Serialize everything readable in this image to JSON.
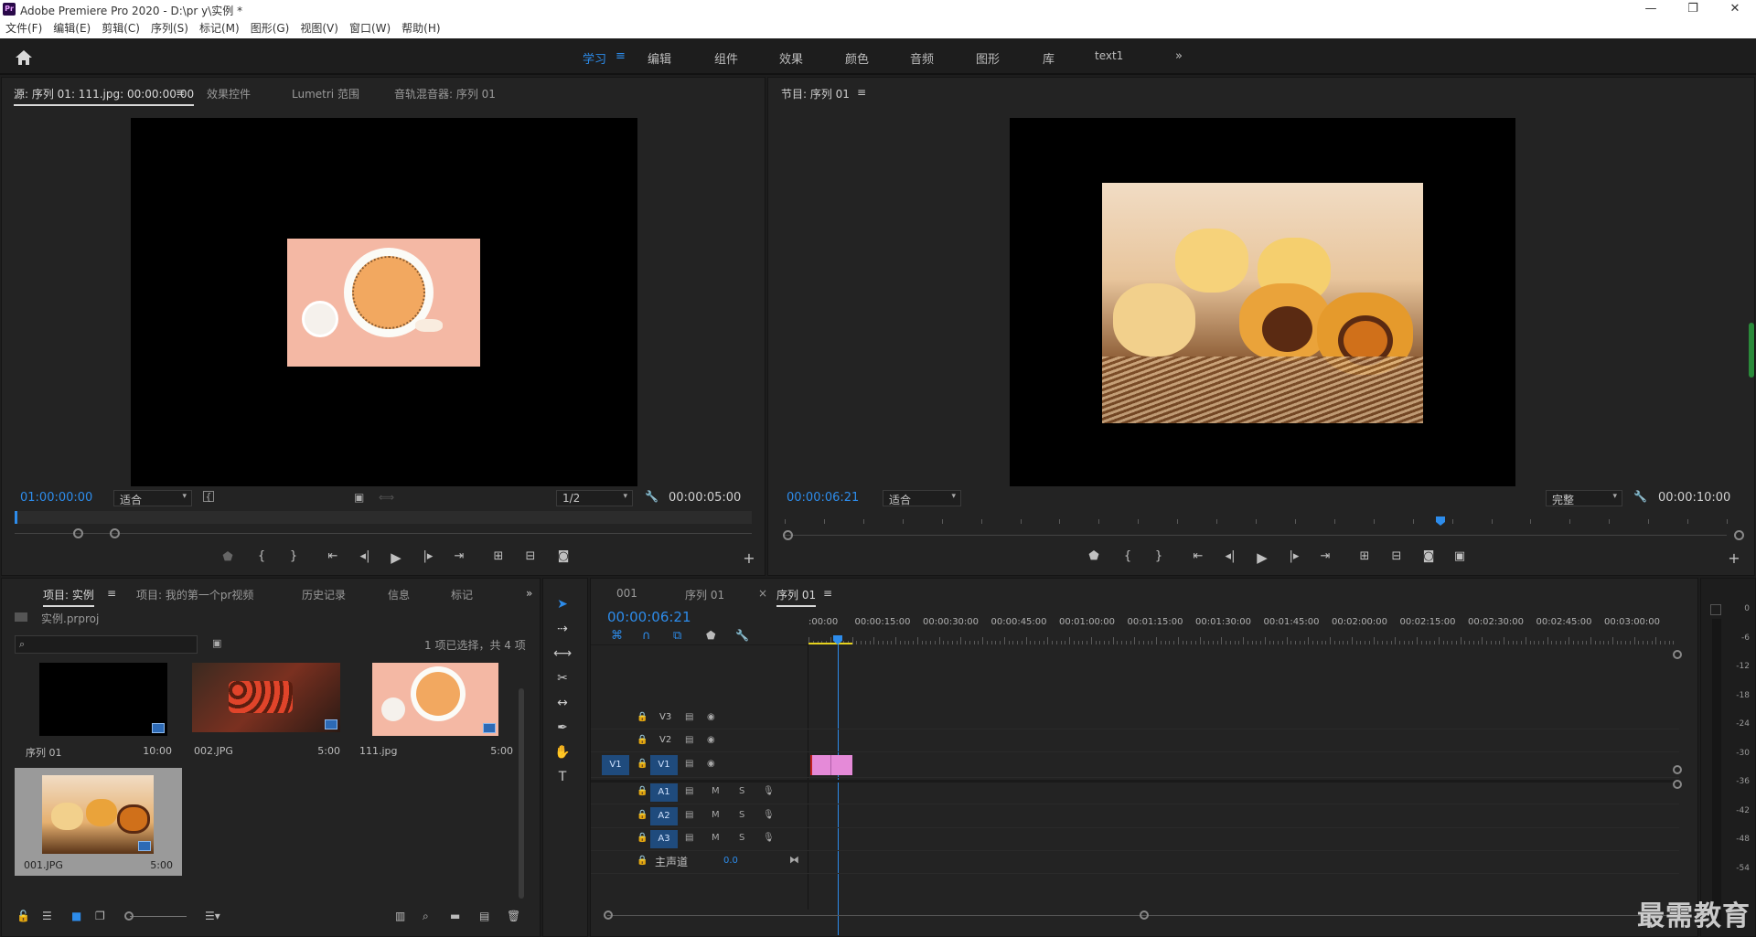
{
  "window": {
    "title": "Adobe Premiere Pro 2020 - D:\\pr y\\实例 *",
    "app_icon": "Pr",
    "controls": [
      "—",
      "❐",
      "✕"
    ]
  },
  "menu": [
    "文件(F)",
    "编辑(E)",
    "剪辑(C)",
    "序列(S)",
    "标记(M)",
    "图形(G)",
    "视图(V)",
    "窗口(W)",
    "帮助(H)"
  ],
  "workspaces": {
    "items": [
      "学习",
      "编辑",
      "组件",
      "效果",
      "颜色",
      "音频",
      "图形",
      "库",
      "text1"
    ],
    "active": "学习",
    "more": "»"
  },
  "source_panel": {
    "tabs": [
      "源: 序列 01: 111.jpg: 00:00:00:00",
      "效果控件",
      "Lumetri 范围",
      "音轨混音器: 序列 01"
    ],
    "timecode_left": "01:00:00:00",
    "zoom": "适合",
    "resolution": "1/2",
    "timecode_right": "00:00:05:00"
  },
  "program_panel": {
    "tab": "节目: 序列 01",
    "timecode_left": "00:00:06:21",
    "zoom": "适合",
    "quality": "完整",
    "timecode_right": "00:00:10:00"
  },
  "project_panel": {
    "tabs": [
      "项目: 实例",
      "项目: 我的第一个pr视频",
      "历史记录",
      "信息",
      "标记"
    ],
    "file": "实例.prproj",
    "selection": "1 项已选择，共 4 项",
    "items": [
      {
        "name": "序列 01",
        "duration": "10:00"
      },
      {
        "name": "002.JPG",
        "duration": "5:00"
      },
      {
        "name": "111.jpg",
        "duration": "5:00"
      },
      {
        "name": "001.JPG",
        "duration": "5:00"
      }
    ]
  },
  "timeline": {
    "tabs": [
      "001",
      "序列 01",
      "序列 01"
    ],
    "timecode": "00:00:06:21",
    "ruler": [
      ":00:00",
      "00:00:15:00",
      "00:00:30:00",
      "00:00:45:00",
      "00:01:00:00",
      "00:01:15:00",
      "00:01:30:00",
      "00:01:45:00",
      "00:02:00:00",
      "00:02:15:00",
      "00:02:30:00",
      "00:02:45:00",
      "00:03:00:00"
    ],
    "video_tracks": [
      "V3",
      "V2",
      "V1"
    ],
    "audio_tracks": [
      "A1",
      "A2",
      "A3"
    ],
    "source_patch_v": "V1",
    "master": {
      "label": "主声道",
      "value": "0.0"
    },
    "track_btn_m": "M",
    "track_btn_s": "S"
  },
  "meter_labels": [
    "0",
    "-6",
    "-12",
    "-18",
    "-24",
    "-30",
    "-36",
    "-42",
    "-48",
    "-54"
  ],
  "watermark": "最需教育",
  "colors": {
    "accent": "#2d8ceb",
    "clip": "#e58ad8",
    "track_patch": "#1f4b7d"
  }
}
